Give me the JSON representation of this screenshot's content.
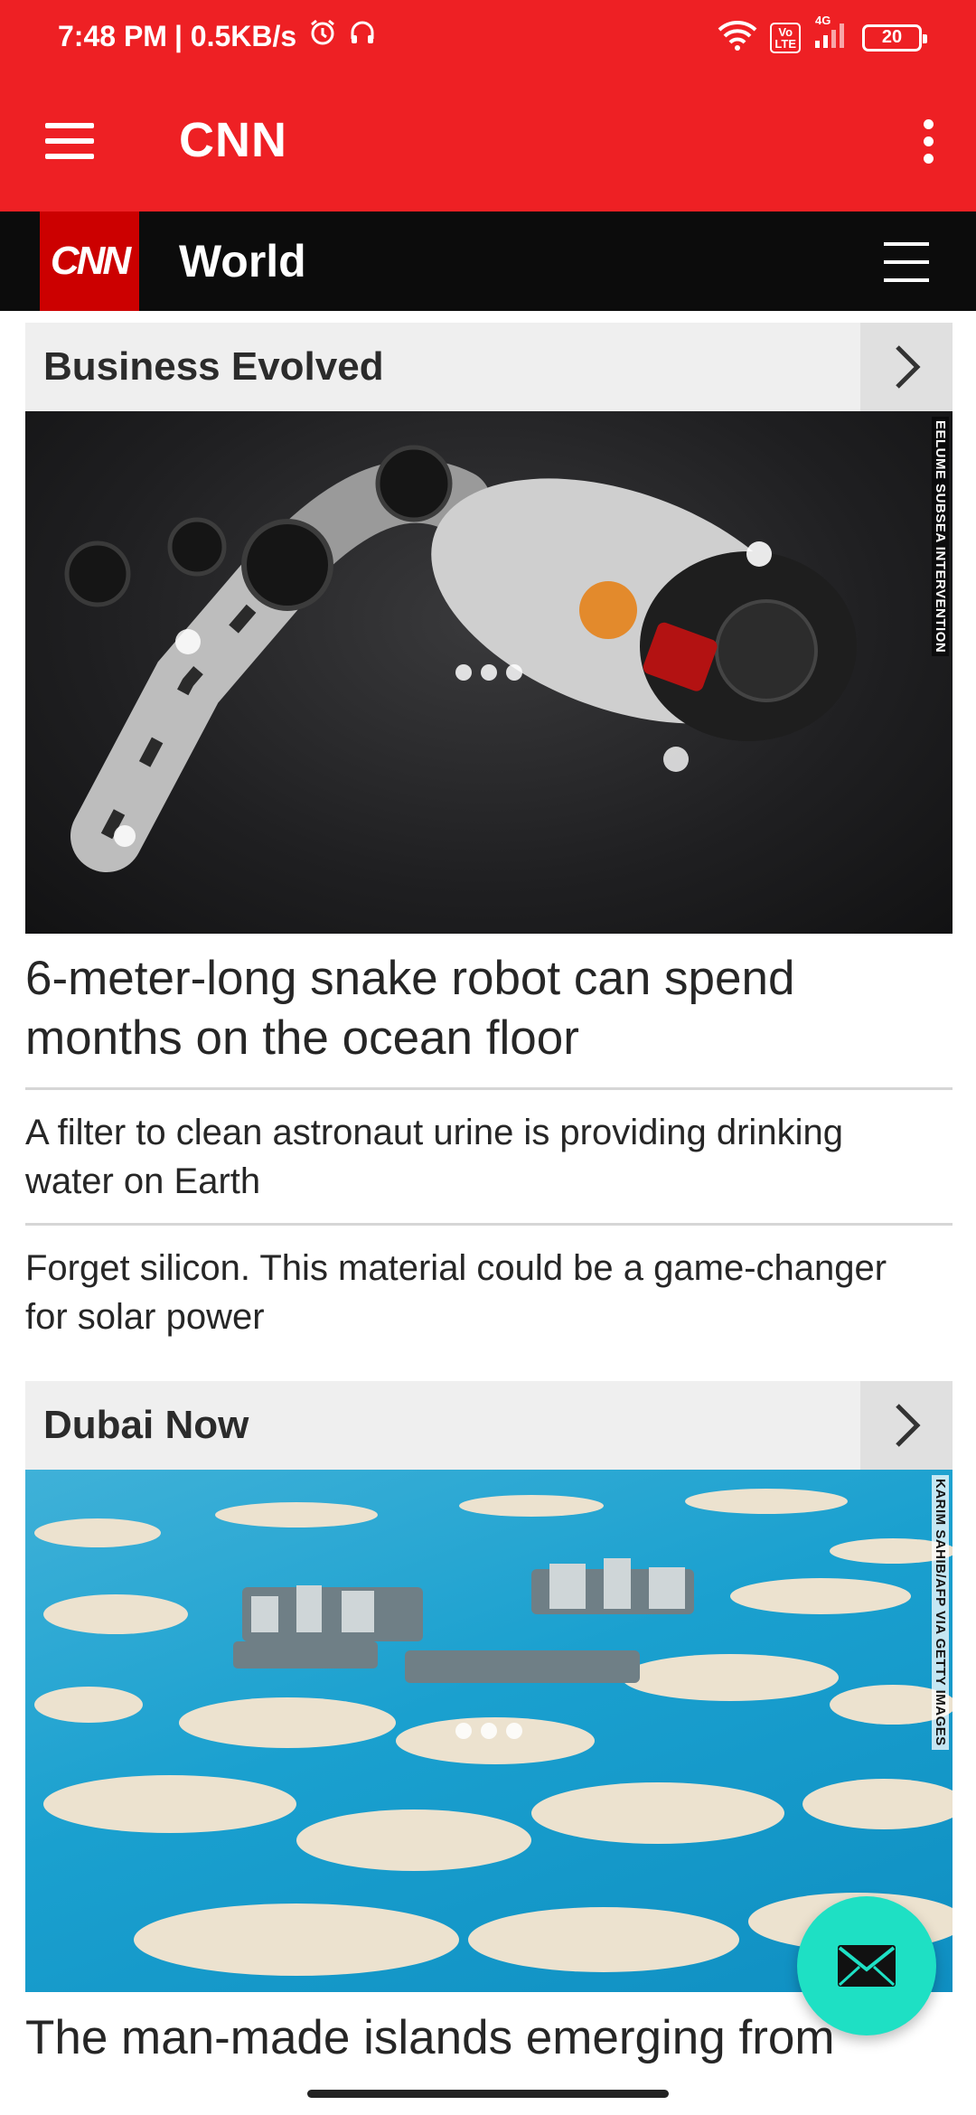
{
  "status_bar": {
    "time": "7:48 PM",
    "speed": "| 0.5KB/s",
    "volte": "Vo\nLTE",
    "network": "4G",
    "battery": "20"
  },
  "app_bar": {
    "title": "CNN"
  },
  "section_nav": {
    "logo": "CNN",
    "title": "World"
  },
  "cards": [
    {
      "header": "Business Evolved",
      "image_credit": "EELUME SUBSEA INTERVENTION",
      "headline": "6-meter-long snake robot can spend months on the ocean floor",
      "stories": [
        "A filter to clean astronaut urine is providing drinking water on Earth",
        "Forget silicon. This material could be a game-changer for solar power"
      ]
    },
    {
      "header": "Dubai Now",
      "image_credit": "KARIM SAHIB/AFP VIA GETTY IMAGES",
      "headline": "The man-made islands emerging from"
    }
  ],
  "colors": {
    "brand_red": "#ee2024",
    "nav_black": "#0c0c0c",
    "fab_teal": "#1ee0c4"
  },
  "icons": {
    "fab": "mail-icon",
    "card_arrow": "chevron-right-icon"
  }
}
